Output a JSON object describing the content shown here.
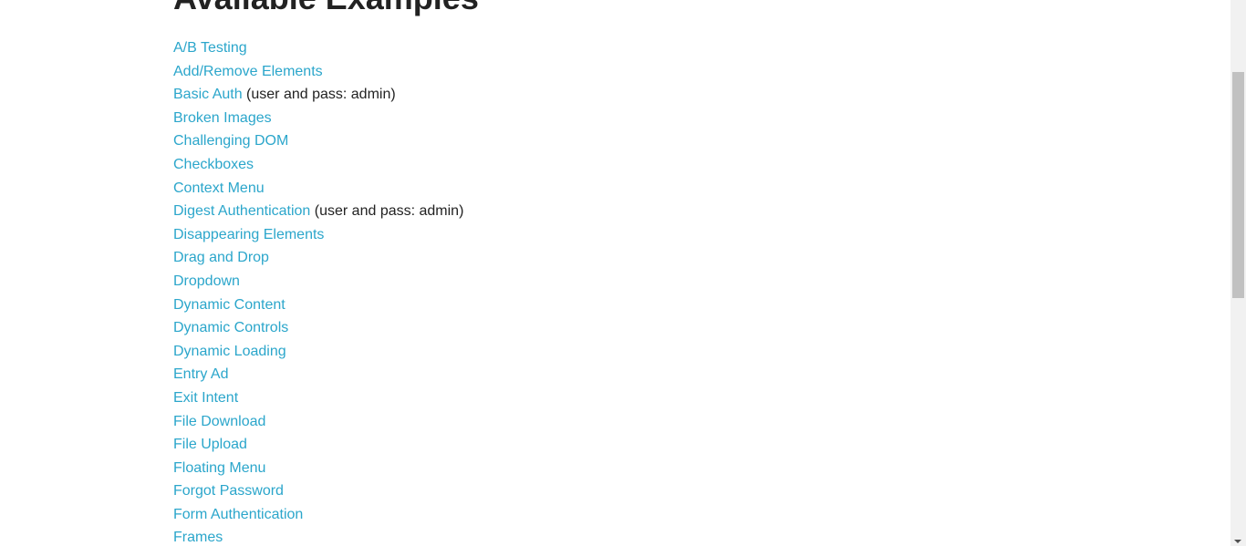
{
  "heading": "Available Examples",
  "examples": [
    {
      "label": "A/B Testing",
      "note": ""
    },
    {
      "label": "Add/Remove Elements",
      "note": ""
    },
    {
      "label": "Basic Auth",
      "note": " (user and pass: admin)"
    },
    {
      "label": "Broken Images",
      "note": ""
    },
    {
      "label": "Challenging DOM",
      "note": ""
    },
    {
      "label": "Checkboxes",
      "note": ""
    },
    {
      "label": "Context Menu",
      "note": ""
    },
    {
      "label": "Digest Authentication",
      "note": " (user and pass: admin)"
    },
    {
      "label": "Disappearing Elements",
      "note": ""
    },
    {
      "label": "Drag and Drop",
      "note": ""
    },
    {
      "label": "Dropdown",
      "note": ""
    },
    {
      "label": "Dynamic Content",
      "note": ""
    },
    {
      "label": "Dynamic Controls",
      "note": ""
    },
    {
      "label": "Dynamic Loading",
      "note": ""
    },
    {
      "label": "Entry Ad",
      "note": ""
    },
    {
      "label": "Exit Intent",
      "note": ""
    },
    {
      "label": "File Download",
      "note": ""
    },
    {
      "label": "File Upload",
      "note": ""
    },
    {
      "label": "Floating Menu",
      "note": ""
    },
    {
      "label": "Forgot Password",
      "note": ""
    },
    {
      "label": "Form Authentication",
      "note": ""
    },
    {
      "label": "Frames",
      "note": ""
    }
  ],
  "colors": {
    "link": "#2ba6cb",
    "text": "#222222",
    "scrollbar_track": "#f1f1f1",
    "scrollbar_thumb": "#c1c1c1"
  }
}
